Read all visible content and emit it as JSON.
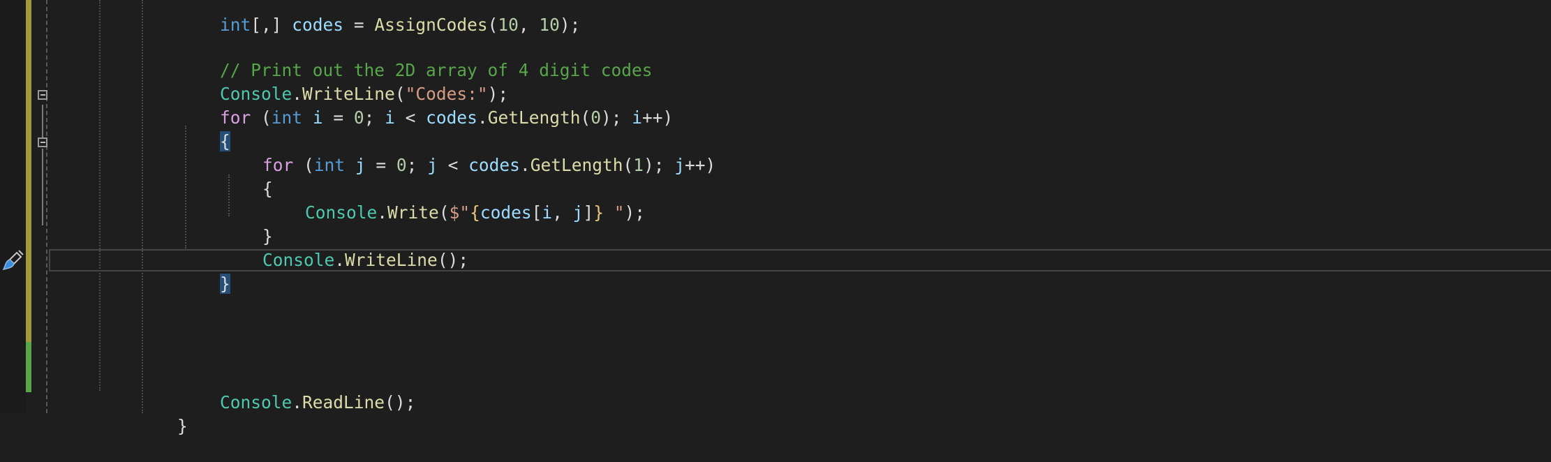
{
  "lines": {
    "l0": {
      "k1": "int",
      "p1": "[,] ",
      "v1": "codes",
      "p2": " = ",
      "m1": "AssignCodes",
      "p3": "(",
      "n1": "10",
      "p4": ", ",
      "n2": "10",
      "p5": ");"
    },
    "l1": {
      "c1": "// Print out the 2D array of 4 digit codes"
    },
    "l2": {
      "cl1": "Console",
      "p1": ".",
      "m1": "WriteLine",
      "p2": "(",
      "s1": "\"Codes:\"",
      "p3": ");"
    },
    "l3": {
      "k1": "for",
      "p1": " (",
      "k2": "int",
      "p2": " ",
      "v1": "i",
      "p3": " = ",
      "n1": "0",
      "p4": "; ",
      "v2": "i",
      "p5": " < ",
      "v3": "codes",
      "p6": ".",
      "m1": "GetLength",
      "p7": "(",
      "n2": "0",
      "p8": "); ",
      "v4": "i",
      "p9": "++)"
    },
    "l4": {
      "b1": "{"
    },
    "l5": {
      "k1": "for",
      "p1": " (",
      "k2": "int",
      "p2": " ",
      "v1": "j",
      "p3": " = ",
      "n1": "0",
      "p4": "; ",
      "v2": "j",
      "p5": " < ",
      "v3": "codes",
      "p6": ".",
      "m1": "GetLength",
      "p7": "(",
      "n2": "1",
      "p8": "); ",
      "v4": "j",
      "p9": "++)"
    },
    "l6": {
      "b1": "{"
    },
    "l7": {
      "cl1": "Console",
      "p1": ".",
      "m1": "Write",
      "p2": "(",
      "s1": "$\"",
      "e1": "{",
      "v1": "codes",
      "p3": "[",
      "v2": "i",
      "p4": ", ",
      "v3": "j",
      "p5": "]",
      "e2": "}",
      "s2": " \"",
      "p6": ");"
    },
    "l8": {
      "b1": "}"
    },
    "l9": {
      "cl1": "Console",
      "p1": ".",
      "m1": "WriteLine",
      "p2": "();"
    },
    "l10": {
      "b1": "}"
    },
    "l14": {
      "cl1": "Console",
      "p1": ".",
      "m1": "ReadLine",
      "p2": "();"
    },
    "l15": {
      "b1": "}"
    }
  },
  "colors": {
    "background": "#1e1e1e",
    "keyword": "#d8a0df",
    "type": "#569cd6",
    "class": "#4ec9b0",
    "method": "#dcdcaa",
    "variable": "#9cdcfe",
    "string": "#d69d85",
    "number": "#b5cea8",
    "comment": "#57a64a",
    "modified_bar": "#a39a3c",
    "saved_bar": "#57a64a"
  },
  "icons": {
    "fold": "collapse-minus-icon",
    "quick_action": "paintbrush-icon"
  }
}
